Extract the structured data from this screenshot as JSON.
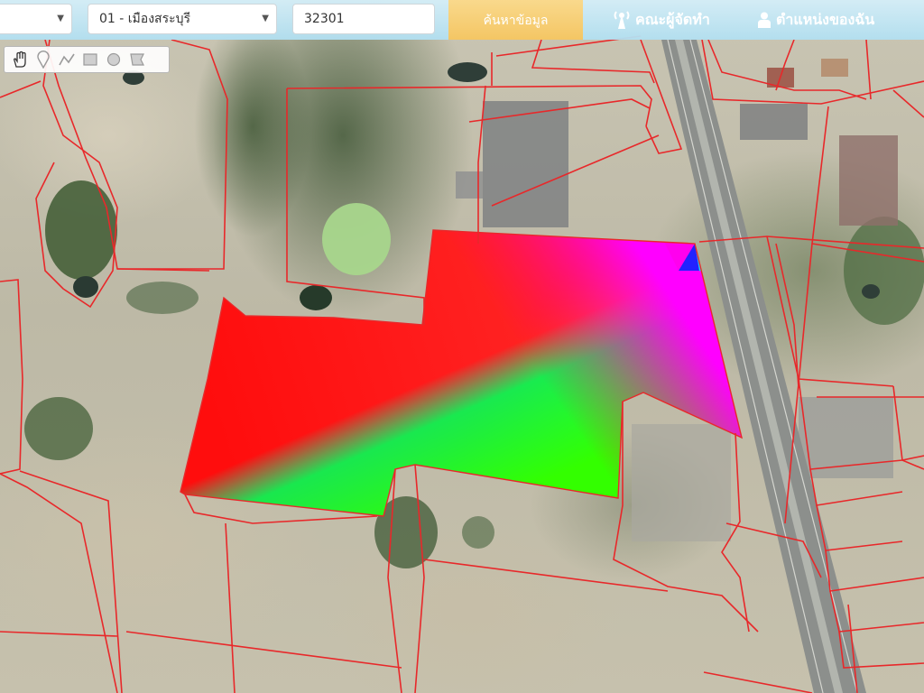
{
  "search_bar": {
    "province_value": "",
    "district_value": "01 - เมืองสระบุรี",
    "deed_number_value": "32301",
    "search_button_label": "ค้นหาข้อมูล"
  },
  "header": {
    "team_link_label": "คณะผู้จัดทำ",
    "location_link_label": "ตำแหน่งของฉัน"
  },
  "map_tools": [
    "pan-hand-icon",
    "marker-icon",
    "polyline-icon",
    "rectangle-icon",
    "circle-icon",
    "polygon-icon"
  ],
  "colors": {
    "parcel_boundary": "#e8282a",
    "search_button": "#f6c96f",
    "header_bar": "#bfe6f5",
    "highlight_gradient": [
      "#ff0000",
      "#ff00ff",
      "#0000ff",
      "#00ff00",
      "#ffff00"
    ]
  }
}
